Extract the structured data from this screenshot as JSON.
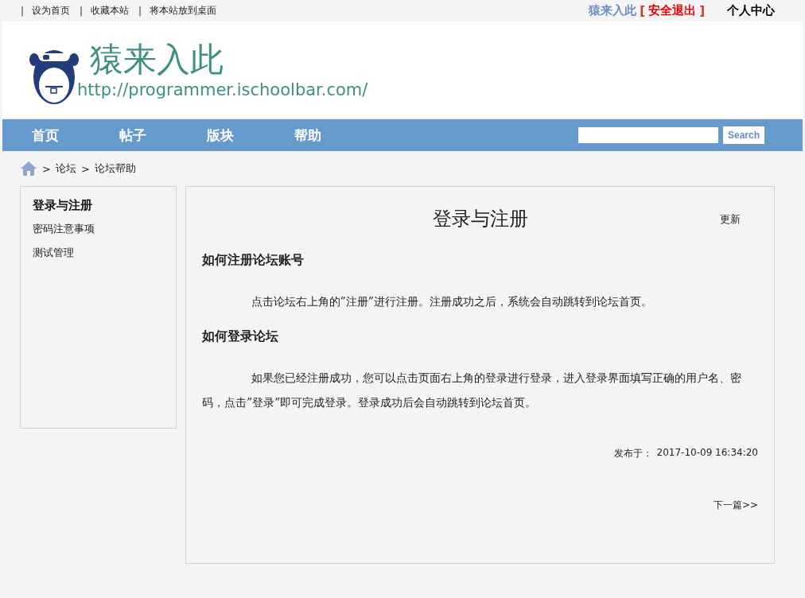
{
  "top_links": [
    {
      "sep": "|",
      "label": "设为首页"
    },
    {
      "sep": "|",
      "label": "收藏本站"
    },
    {
      "sep": "|",
      "label": "将本站放到桌面"
    }
  ],
  "user": {
    "name": "猿来入此",
    "open": "[",
    "logout": "安全退出",
    "close": "]",
    "center": "个人中心"
  },
  "brand": {
    "title": "猿来入此",
    "url": "http://programmer.ischoolbar.com/"
  },
  "nav": {
    "items": [
      "首页",
      "帖子",
      "版块",
      "帮助"
    ],
    "search_button": "Search"
  },
  "breadcrumb": [
    {
      "sep": ">",
      "label": "论坛"
    },
    {
      "sep": ">",
      "label": "论坛帮助"
    }
  ],
  "sidebar": {
    "items": [
      {
        "label": "登录与注册",
        "selected": true
      },
      {
        "label": "密码注意事项",
        "selected": false
      },
      {
        "label": "测试管理",
        "selected": false
      }
    ]
  },
  "article": {
    "title": "登录与注册",
    "update": "更新",
    "sections": [
      {
        "heading": "如何注册论坛账号",
        "body": "点击论坛右上角的”注册”进行注册。注册成功之后，系统会自动跳转到论坛首页。"
      },
      {
        "heading": "如何登录论坛",
        "body": "如果您已经注册成功，您可以点击页面右上角的登录进行登录，进入登录界面填写正确的用户名、密码，点击”登录”即可完成登录。登录成功后会自动跳转到论坛首页。"
      }
    ],
    "published_label": "发布于：",
    "published": "2017-10-09 16:34:20",
    "next": "下一篇>>"
  }
}
